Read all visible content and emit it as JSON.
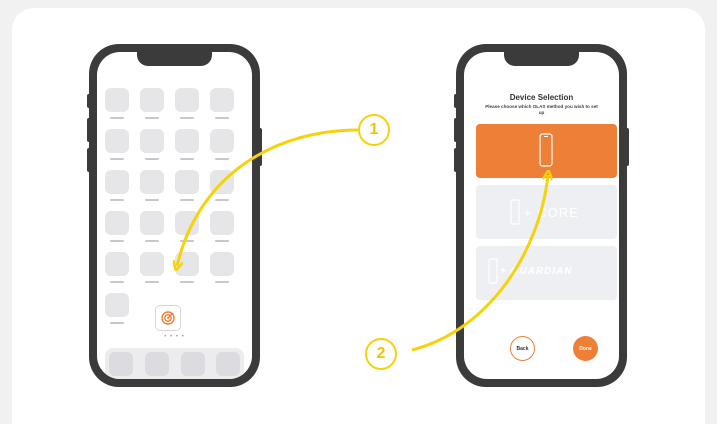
{
  "left_phone": {
    "home_dots": "• • • •",
    "olas_app_icon": "radar-icon"
  },
  "right_phone": {
    "title": "Device Selection",
    "subtitle": "Please choose which OLAS method you wish to set up",
    "options": [
      {
        "label": "",
        "icon": "phone-icon",
        "selected": true
      },
      {
        "label": "+ CORE",
        "icon": "core-device-icon",
        "selected": false
      },
      {
        "label": "+ GUARDIAN",
        "icon": "guardian-device-icon",
        "selected": false
      }
    ],
    "back_label": "Back",
    "done_label": "Done"
  },
  "steps": [
    {
      "number": "1"
    },
    {
      "number": "2"
    }
  ],
  "colors": {
    "accent": "#ee7f36",
    "highlight": "#f5d20c",
    "phone_body": "#3b3b3b",
    "option_bg": "#eeeff2"
  }
}
